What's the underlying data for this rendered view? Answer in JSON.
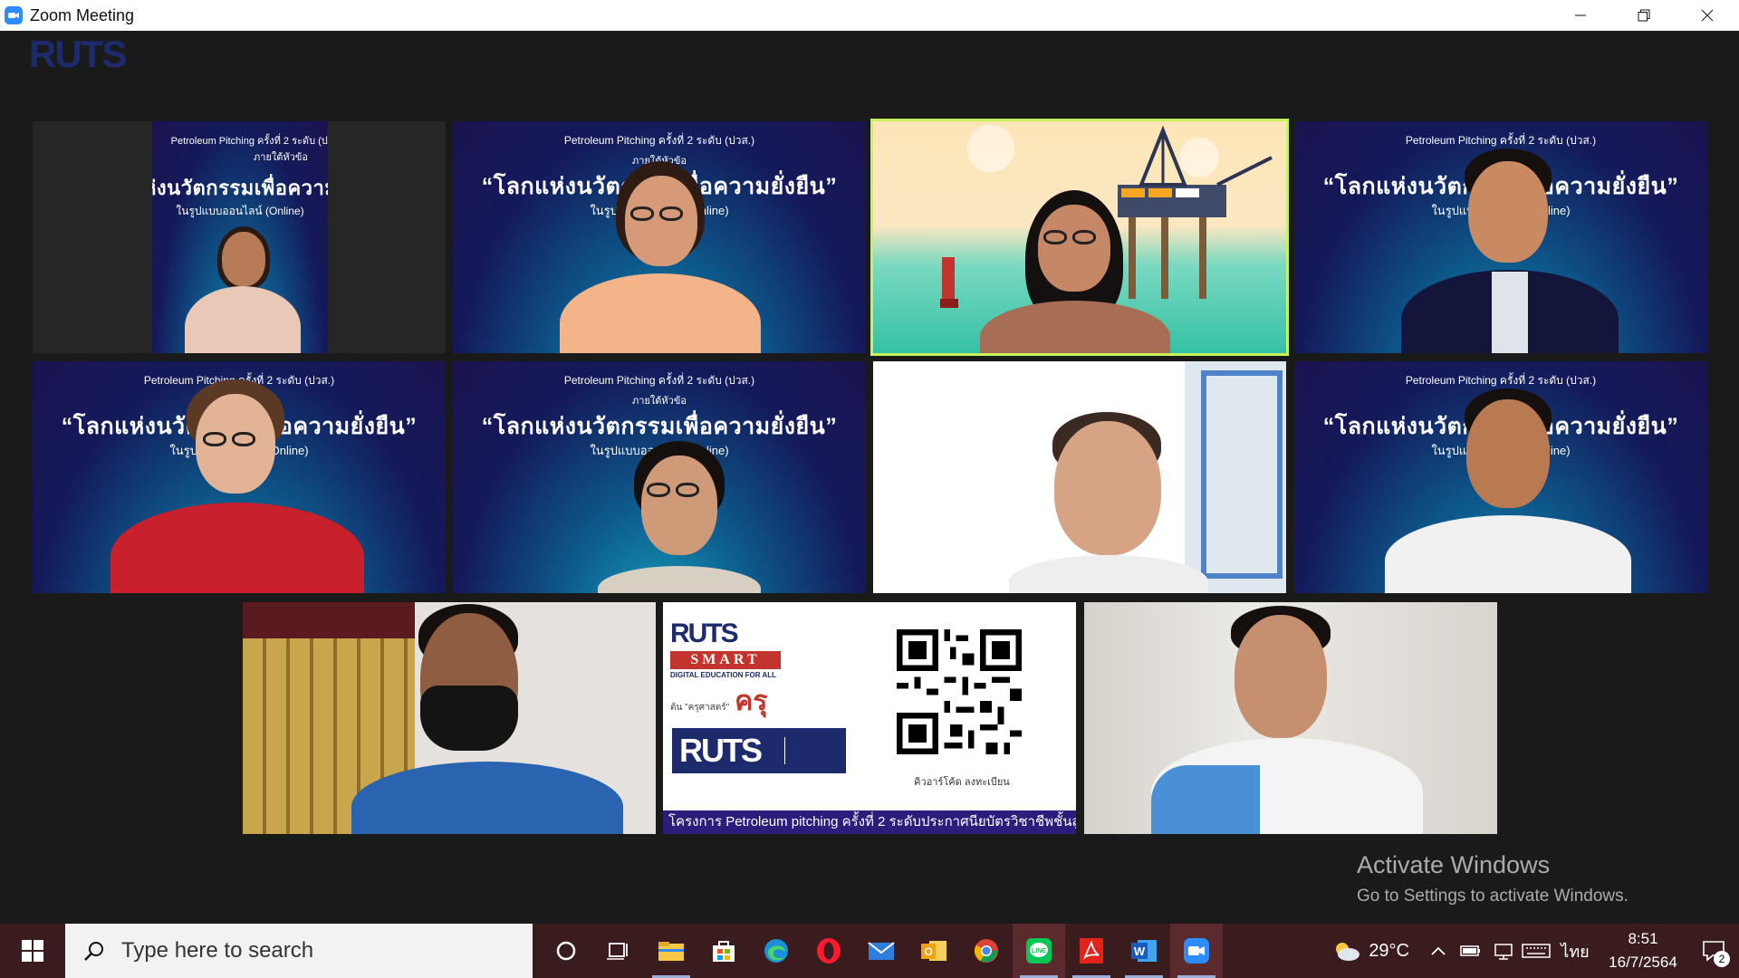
{
  "window": {
    "title": "Zoom Meeting",
    "controls": [
      "minimize",
      "restore",
      "close"
    ]
  },
  "meeting": {
    "brand_logo": "RUTS",
    "background_slide": {
      "line1": "Petroleum Pitching ครั้งที่ 2 ระดับ (ปวส.)",
      "line2": "ภายใต้หัวข้อ",
      "line3": "“โลกแห่งนวัตกรรมเพื่อความยั่งยืน”",
      "line4": "ในรูปแบบออนไลน์ (Online)"
    },
    "tiles": [
      {
        "id": "p1",
        "type": "virtual-bg-narrow",
        "active": false
      },
      {
        "id": "p2",
        "type": "virtual-bg",
        "active": false
      },
      {
        "id": "p3",
        "type": "scene",
        "active": true
      },
      {
        "id": "p4",
        "type": "virtual-bg",
        "active": false
      },
      {
        "id": "p5",
        "type": "virtual-bg",
        "active": false
      },
      {
        "id": "p6",
        "type": "virtual-bg",
        "active": false
      },
      {
        "id": "p7",
        "type": "white",
        "active": false
      },
      {
        "id": "p8",
        "type": "virtual-bg",
        "active": false
      },
      {
        "id": "p9",
        "type": "room",
        "active": false
      },
      {
        "id": "p10",
        "type": "slide",
        "active": false
      },
      {
        "id": "p11",
        "type": "room",
        "active": false
      }
    ],
    "slide_tile": {
      "logo_top": "RUTS",
      "smart": "SMART",
      "digital": "DIGITAL EDUCATION FOR ALL",
      "kru_small": "ต้น \"ครุศาสตร์\"",
      "kru_big": "ครุ",
      "logo_bottom": "RUTS",
      "qr_label": "คิวอาร์โค้ด ลงทะเบียน",
      "banner": "โครงการ Petroleum pitching ครั้งที่ 2 ระดับประกาศนียบัตรวิชาชีพชั้นสูง"
    }
  },
  "watermark": {
    "title": "Activate Windows",
    "subtitle": "Go to Settings to activate Windows."
  },
  "taskbar": {
    "search_placeholder": "Type here to search",
    "apps": [
      "cortana-icon",
      "task-view-icon",
      "file-explorer-icon",
      "store-icon",
      "edge-icon",
      "opera-icon",
      "mail-icon",
      "outlook-icon",
      "chrome-icon",
      "line-icon",
      "acrobat-icon",
      "word-icon",
      "zoom-icon"
    ],
    "weather": "29°C",
    "language": "ไทย",
    "time": "8:51",
    "date": "16/7/2564",
    "notification_count": "2"
  },
  "colors": {
    "active_speaker_border": "#c8f25c",
    "taskbar": "#3a1c1f",
    "zoom_blue": "#2d8cff"
  }
}
